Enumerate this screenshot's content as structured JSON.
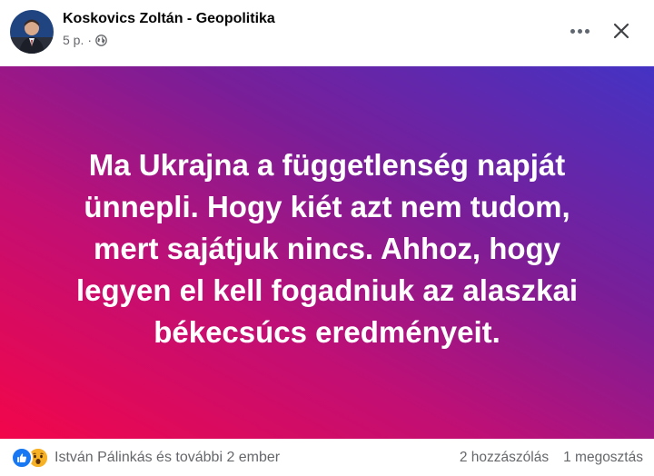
{
  "post": {
    "author": "Koskovics Zoltán - Geopolitika",
    "time": "5 p.",
    "separator": "·",
    "privacy_icon": "globe-icon",
    "header_icons": [
      "more-options-icon",
      "close-icon"
    ],
    "text": "Ma Ukrajna a függetlenség napját\nünnepli. Hogy kiét azt nem tudom,\nmert sajátjuk nincs. Ahhoz, hogy\nlegyen el kell fogadniuk az alaszkai\nbékecsúcs eredményeit.",
    "background_colors": [
      "#f2064a",
      "#c10f74",
      "#7a1e98",
      "#4433c4"
    ]
  },
  "footer": {
    "reaction_icons": [
      "like-icon",
      "wow-icon"
    ],
    "reactors": "István Pálinkás és további 2 ember",
    "comments": "2 hozzászólás",
    "shares": "1 megosztás"
  },
  "colors": {
    "like": "#1877f2",
    "wow": "#f7b125",
    "secondary_text": "#65676b",
    "primary_text": "#050505"
  }
}
